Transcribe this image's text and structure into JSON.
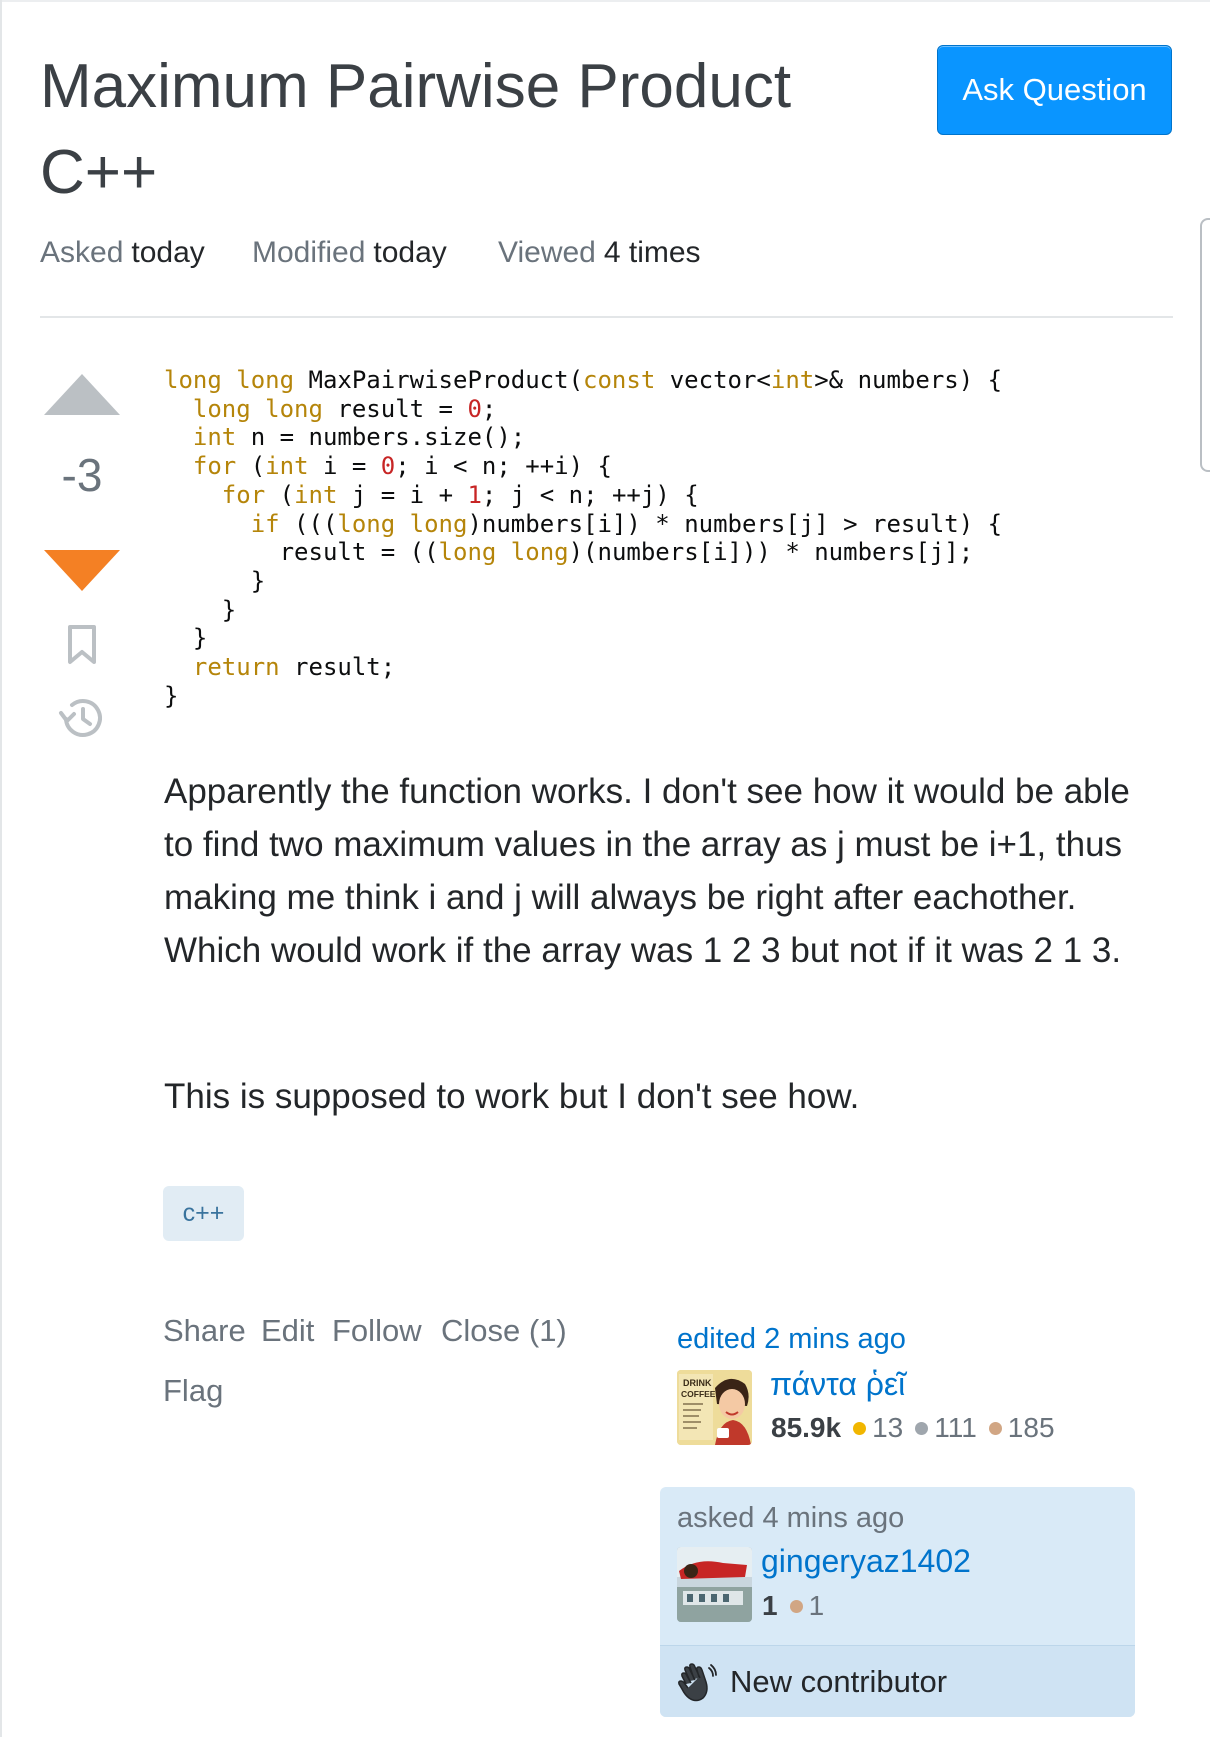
{
  "question": {
    "title_line1": "Maximum Pairwise Product",
    "title_line2": "C++",
    "ask_button": "Ask Question",
    "meta": [
      {
        "key": "Asked",
        "value": "today"
      },
      {
        "key": "Modified",
        "value": "today"
      },
      {
        "key": "Viewed",
        "value": "4 times"
      }
    ],
    "vote_count": "-3",
    "body": {
      "paragraph1": "Apparently the function works. I don't see how it would be able to find two maximum values in the array as j must be i+1, thus making me think i and j will always be right after eachother. Which would work if the array was 1 2 3 but not if it was 2 1 3.",
      "paragraph2": "This is supposed to work but I don't see how."
    },
    "tags": [
      "c++"
    ],
    "actions": [
      "Share",
      "Edit",
      "Follow",
      "Close (1)",
      "Flag"
    ],
    "editor": {
      "label": "edited 2 mins ago",
      "name": "πάντα ῥεῖ",
      "reputation": "85.9k",
      "gold": "13",
      "silver": "111",
      "bronze": "185"
    },
    "author": {
      "label": "asked 4 mins ago",
      "name": "gingeryaz1402",
      "reputation": "1",
      "bronze": "1",
      "badge": "New contributor"
    },
    "colors": {
      "accent": "#0a95ff",
      "downvote": "#f48024",
      "upvote": "#bbc0c4",
      "tag_bg": "#e1ecf4",
      "link": "#0074cc"
    }
  }
}
